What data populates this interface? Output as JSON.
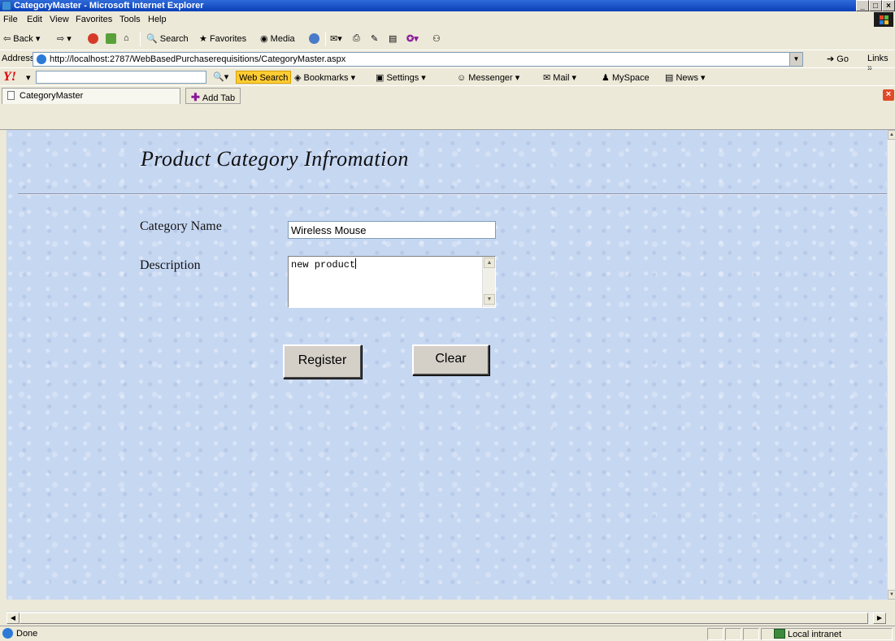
{
  "window": {
    "title": "CategoryMaster - Microsoft Internet Explorer",
    "minimize": "_",
    "maximize": "□",
    "close": "×"
  },
  "menu": [
    "File",
    "Edit",
    "View",
    "Favorites",
    "Tools",
    "Help"
  ],
  "toolbar": {
    "back": "Back",
    "search": "Search",
    "favorites": "Favorites",
    "media": "Media"
  },
  "address": {
    "label": "Address",
    "url": "http://localhost:2787/WebBasedPurchaserequisitions/CategoryMaster.aspx",
    "go": "Go",
    "links": "Links"
  },
  "yahoo": {
    "logo": "Y!",
    "search_button": "Web Search",
    "bookmarks": "Bookmarks",
    "settings": "Settings",
    "messenger": "Messenger",
    "mail": "Mail",
    "myspace": "MySpace",
    "news": "News"
  },
  "tabs": {
    "active": "CategoryMaster",
    "add": "Add Tab"
  },
  "page": {
    "heading": "Product Category Infromation",
    "category_label": "Category Name",
    "category_value": "Wireless Mouse",
    "description_label": "Description",
    "description_value": "new product",
    "register": "Register",
    "clear": "Clear"
  },
  "status": {
    "text": "Done",
    "zone": "Local intranet"
  },
  "colors": {
    "page_background": "#c6d7f2",
    "title_bar": "#0a3fb8",
    "chrome": "#ece9d8"
  }
}
